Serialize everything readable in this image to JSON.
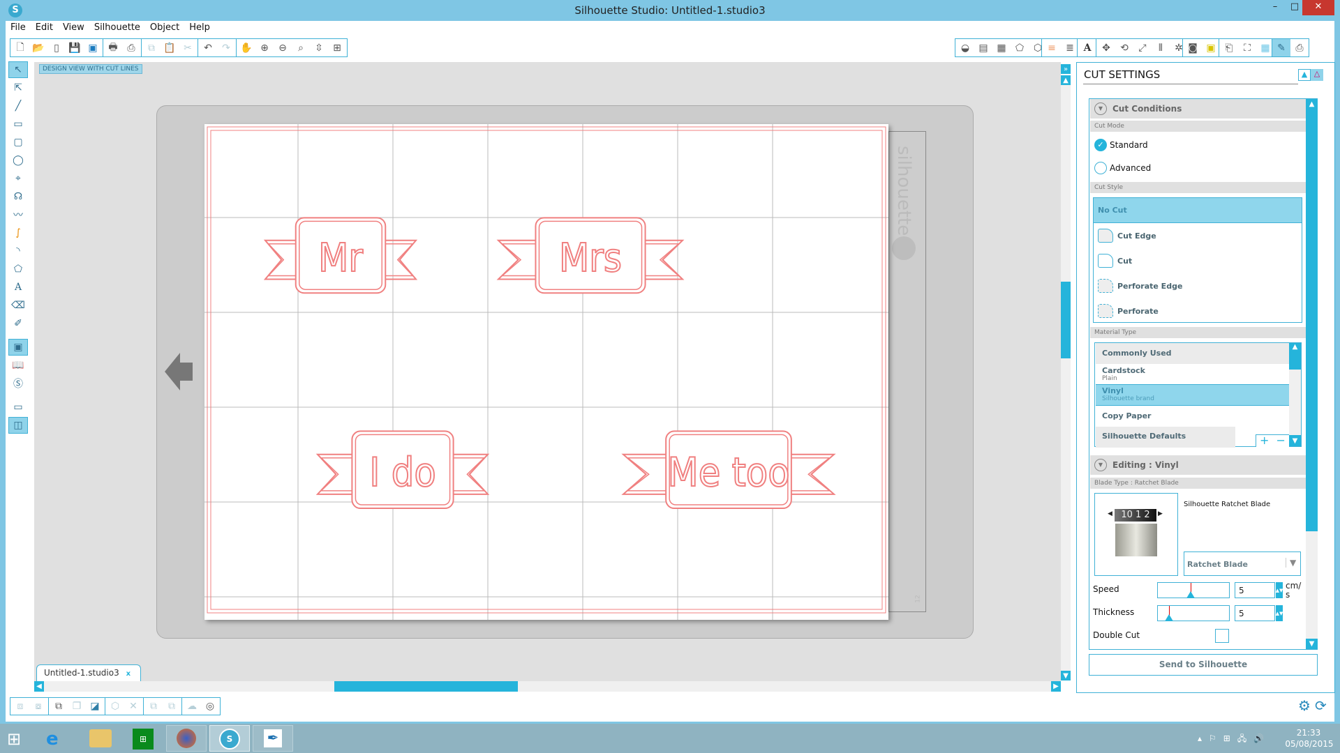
{
  "window": {
    "title": "Silhouette Studio: Untitled-1.studio3",
    "minimize": "–",
    "maximize": "□",
    "close": "✕"
  },
  "menu": [
    "File",
    "Edit",
    "View",
    "Silhouette",
    "Object",
    "Help"
  ],
  "view_label": "DESIGN VIEW WITH CUT LINES",
  "design": {
    "texts": [
      "Mr",
      "Mrs",
      "I do",
      "Me too"
    ],
    "outline_color": "#f08080"
  },
  "mat_brand": "silhouette",
  "mat_ruler_number": "12",
  "document_tab": {
    "name": "Untitled-1.studio3",
    "close": "x"
  },
  "accent_color": "#25b4db",
  "cut_settings": {
    "title": "CUT SETTINGS",
    "cut_conditions": "Cut Conditions",
    "cut_mode_label": "Cut Mode",
    "cut_modes": [
      {
        "label": "Standard",
        "selected": true
      },
      {
        "label": "Advanced",
        "selected": false
      }
    ],
    "cut_style_label": "Cut Style",
    "cut_styles": [
      {
        "label": "No Cut",
        "selected": true
      },
      {
        "label": "Cut Edge"
      },
      {
        "label": "Cut"
      },
      {
        "label": "Perforate Edge"
      },
      {
        "label": "Perforate"
      }
    ],
    "material_type_label": "Material Type",
    "materials": [
      {
        "label": "Commonly Used",
        "group": true
      },
      {
        "label": "Cardstock",
        "sub": "Plain"
      },
      {
        "label": "Vinyl",
        "sub": "Silhouette brand",
        "selected": true
      },
      {
        "label": "Copy Paper"
      },
      {
        "label": "Silhouette Defaults",
        "group": true
      }
    ],
    "add": "+",
    "remove": "−",
    "editing": "Editing : Vinyl",
    "blade_type_label": "Blade Type : Ratchet Blade",
    "blade_name": "Silhouette Ratchet Blade",
    "blade_dial": "10 1 2",
    "blade_select": "Ratchet Blade",
    "speed_label": "Speed",
    "speed_value": "5",
    "speed_unit": "cm/ s",
    "speed_slider_fraction": 0.45,
    "thickness_label": "Thickness",
    "thickness_value": "5",
    "thickness_slider_fraction": 0.15,
    "double_cut_label": "Double Cut",
    "double_cut": false,
    "send_button": "Send to Silhouette"
  },
  "taskbar": {
    "time": "21:33",
    "date": "05/08/2015"
  }
}
